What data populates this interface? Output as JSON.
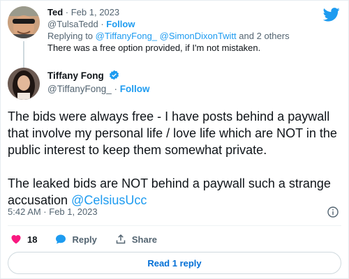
{
  "reply_tweet": {
    "name": "Ted",
    "date": "Feb 1, 2023",
    "handle": "@TulsaTedd",
    "follow": "Follow",
    "replying_prefix": "Replying to",
    "replying_to_1": "@TiffanyFong_",
    "replying_to_2": "@SimonDixonTwitt",
    "replying_suffix": "and 2 others",
    "text": "There was a free option provided, if I'm not mistaken.",
    "avatar_icon": "avatar-sunglasses-icon"
  },
  "main_tweet": {
    "name": "Tiffany Fong",
    "handle": "@TiffanyFong_",
    "follow": "Follow",
    "verified_icon": "verified-badge-icon",
    "paragraph_1": "The bids were always free - I have posts behind a paywall that involve my personal life / love life which are NOT in the public interest to keep them somewhat private.",
    "paragraph_2_text": "The leaked bids are NOT behind a paywall such a strange accusation ",
    "paragraph_2_mention": "@CelsiusUcc",
    "timestamp": "5:42 AM · Feb 1, 2023"
  },
  "actions": {
    "like_count": "18",
    "reply_label": "Reply",
    "share_label": "Share"
  },
  "read_replies_label": "Read 1 reply",
  "colors": {
    "accent": "#1d9bf0",
    "like": "#f91880",
    "muted": "#536471",
    "text": "#0f1419"
  }
}
